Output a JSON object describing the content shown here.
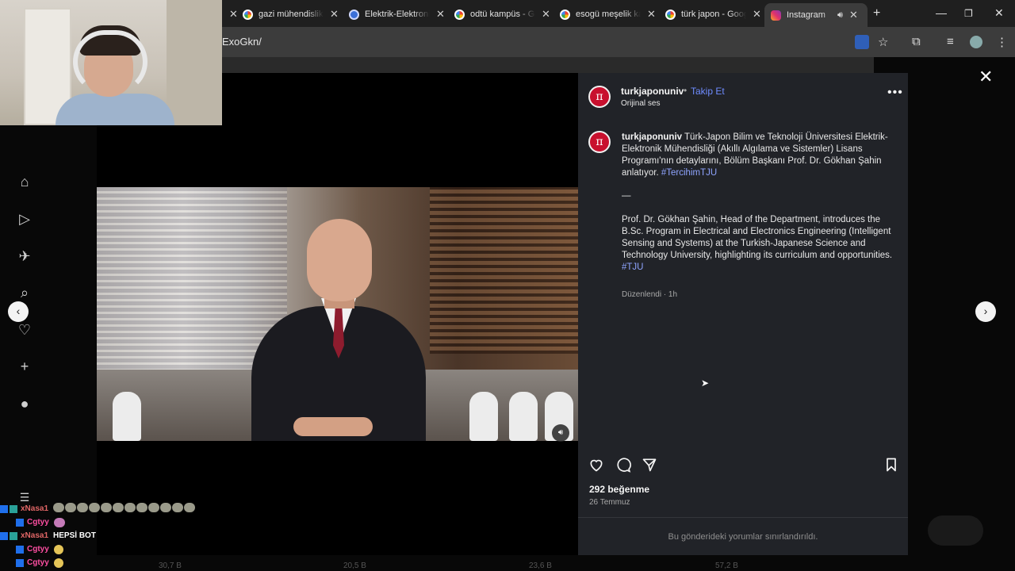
{
  "browser": {
    "tabs": [
      {
        "title": "gazi mühendislik",
        "icon": "google-icon"
      },
      {
        "title": "Elektrik-Elektronik",
        "icon": "site-icon"
      },
      {
        "title": "odtü kampüs - Google",
        "icon": "google-icon"
      },
      {
        "title": "esogü meşelik kampüs",
        "icon": "google-icon"
      },
      {
        "title": "türk japon - Google",
        "icon": "google-icon"
      },
      {
        "title": "Instagram",
        "icon": "instagram-icon"
      }
    ],
    "url": "ExoGkn/"
  },
  "post": {
    "username": "turkjaponuniv",
    "follow_label": "Takip Et",
    "audio": "Orijinal ses",
    "caption_tr": "Türk-Japon Bilim ve Teknoloji Üniversitesi Elektrik-Elektronik Mühendisliği (Akıllı Algılama ve Sistemler) Lisans Programı'nın detaylarını, Bölüm Başkanı Prof. Dr. Gökhan Şahin anlatıyor.",
    "hashtag_tr": "#TercihimTJU",
    "separator": "—",
    "caption_en": "Prof. Dr. Gökhan Şahin, Head of the Department, introduces the B.Sc. Program in Electrical and Electronics Engineering (Intelligent Sensing and Systems) at the Turkish-Japanese Science and Technology University, highlighting its curriculum and opportunities.",
    "hashtag_en": "#TJU",
    "edited": "Düzenlendi · 1h",
    "likes": "292 beğenme",
    "date": "26 Temmuz",
    "comments_limited": "Bu gönderideki yorumlar sınırlandırıldı.",
    "avatar_glyph": "π"
  },
  "chat": [
    {
      "user": "xNasa1",
      "color": "#e06666",
      "message": ""
    },
    {
      "user": "Cgtyy",
      "color": "#ff4fa3",
      "message": ""
    },
    {
      "user": "xNasa1",
      "color": "#e06666",
      "message": "HEPSİ BOT"
    },
    {
      "user": "Cgtyy",
      "color": "#ff4fa3",
      "message": ""
    },
    {
      "user": "Cgtyy",
      "color": "#ff4fa3",
      "message": ""
    }
  ],
  "stats": [
    "30,7 B",
    "20,5 B",
    "23,6 B",
    "57,2 B"
  ],
  "colors": {
    "accent_link": "#6f8cff",
    "panel_bg": "#212328",
    "avatar_red": "#c8102e"
  }
}
